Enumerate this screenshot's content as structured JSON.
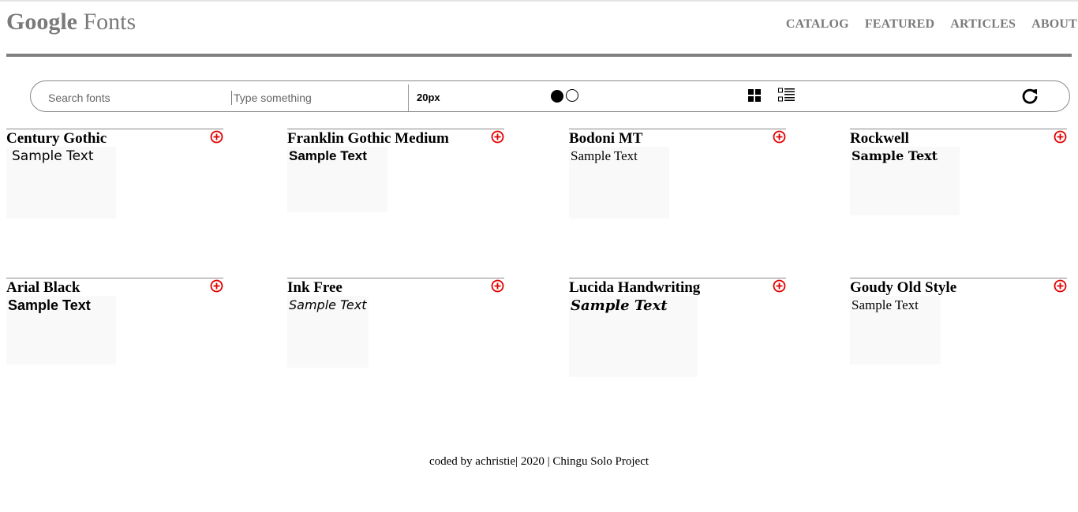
{
  "header": {
    "logo_bold": "Google",
    "logo_light": "Fonts",
    "nav": [
      "CATALOG",
      "FEATURED",
      "ARTICLES",
      "ABOUT"
    ]
  },
  "toolbar": {
    "search_placeholder": "Search fonts",
    "type_placeholder": "Type something",
    "font_size": "20px"
  },
  "fonts": [
    {
      "name": "Century Gothic",
      "sample": "Sample Text"
    },
    {
      "name": "Franklin Gothic Medium",
      "sample": "Sample Text"
    },
    {
      "name": "Bodoni MT",
      "sample": "Sample Text"
    },
    {
      "name": "Rockwell",
      "sample": "Sample Text"
    },
    {
      "name": "Arial Black",
      "sample": "Sample Text"
    },
    {
      "name": "Ink Free",
      "sample": "Sample Text"
    },
    {
      "name": "Lucida Handwriting",
      "sample": "Sample Text"
    },
    {
      "name": "Goudy Old Style",
      "sample": "Sample Text"
    }
  ],
  "footer": {
    "text": "coded by achristie| 2020 | Chingu Solo Project"
  },
  "colors": {
    "accent_red": "#e00000",
    "nav_gray": "#7a7a7a"
  }
}
